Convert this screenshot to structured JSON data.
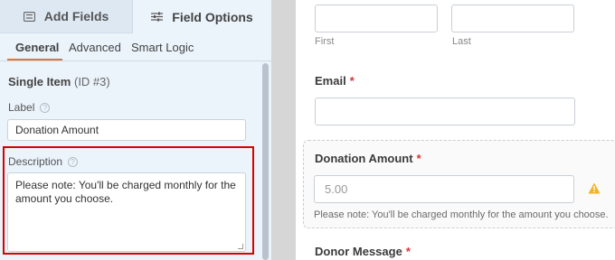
{
  "sidebar": {
    "tabs": {
      "add_fields": "Add Fields",
      "field_options": "Field Options"
    },
    "subtabs": [
      "General",
      "Advanced",
      "Smart Logic"
    ],
    "field": {
      "name": "Single Item",
      "id": "(ID #3)"
    },
    "label_label": "Label",
    "label_value": "Donation Amount",
    "description_label": "Description",
    "description_value": "Please note: You'll be charged monthly for the amount you choose.",
    "help_glyph": "?"
  },
  "preview": {
    "name_sublabels": {
      "first": "First",
      "last": "Last"
    },
    "email": {
      "label": "Email",
      "required_mark": "*"
    },
    "donation": {
      "label": "Donation Amount",
      "required_mark": "*",
      "placeholder": "5.00",
      "description": "Please note: You'll be charged monthly for the amount you choose."
    },
    "donor_message": {
      "label": "Donor Message",
      "required_mark": "*"
    }
  },
  "colors": {
    "accent_orange": "#e27730",
    "highlight_red": "#d90000",
    "required_red": "#d63638",
    "warning_yellow": "#f0b429",
    "sidebar_bg": "#ebf3fb"
  },
  "icons": [
    "list-icon",
    "sliders-icon",
    "help-circle-icon",
    "warning-icon"
  ]
}
